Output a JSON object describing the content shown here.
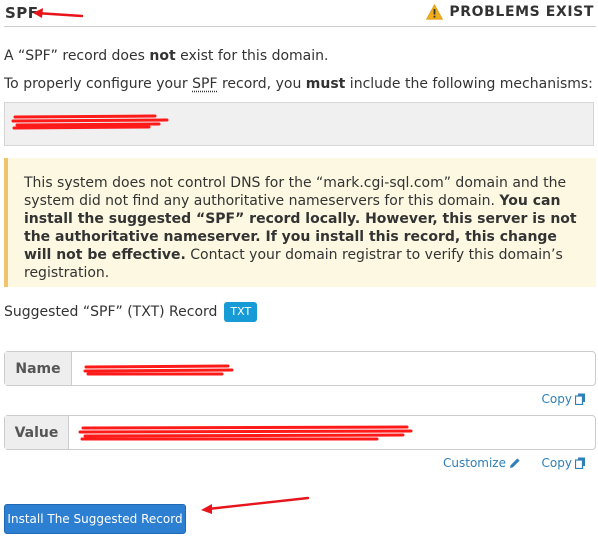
{
  "header": {
    "title": "SPF",
    "status": "PROBLEMS EXIST"
  },
  "body": {
    "line1_pre": "A “SPF” record does ",
    "line1_bold": "not",
    "line1_post": " exist for this domain.",
    "line2_pre": "To properly configure your ",
    "line2_spf": "SPF",
    "line2_mid": " record, you ",
    "line2_bold": "must",
    "line2_post": " include the following mechanisms:"
  },
  "alert": {
    "text_normal": "This system does not control DNS for the “mark.cgi-sql.com” domain and the system did not find any authoritative nameservers for this domain. ",
    "text_bold": "You can install the suggested “SPF” record locally. However, this server is not the authoritative nameserver. If you install this record, this change will not be effective.",
    "text_tail": " Contact your domain registrar to verify this domain’s registration."
  },
  "suggested": {
    "label": "Suggested “SPF” (TXT) Record",
    "badge": "TXT"
  },
  "fields": {
    "name_label": "Name",
    "value_label": "Value"
  },
  "links": {
    "copy_name": "Copy",
    "customize": "Customize",
    "copy_value": "Copy"
  },
  "button": {
    "install": "Install The Suggested Record"
  },
  "colors": {
    "warning_icon": "#f0ad1c",
    "alert_background": "#fcf8e1",
    "alert_border": "#f0c36d",
    "badge": "#179bd7",
    "link": "#2f7fb8",
    "button": "#2d7fd1",
    "annotation_arrow": "#e8141b",
    "redaction": "#ff1a1a"
  },
  "icons": {
    "status": "warning-triangle-icon",
    "copy": "copy-icon",
    "customize": "pencil-icon"
  }
}
